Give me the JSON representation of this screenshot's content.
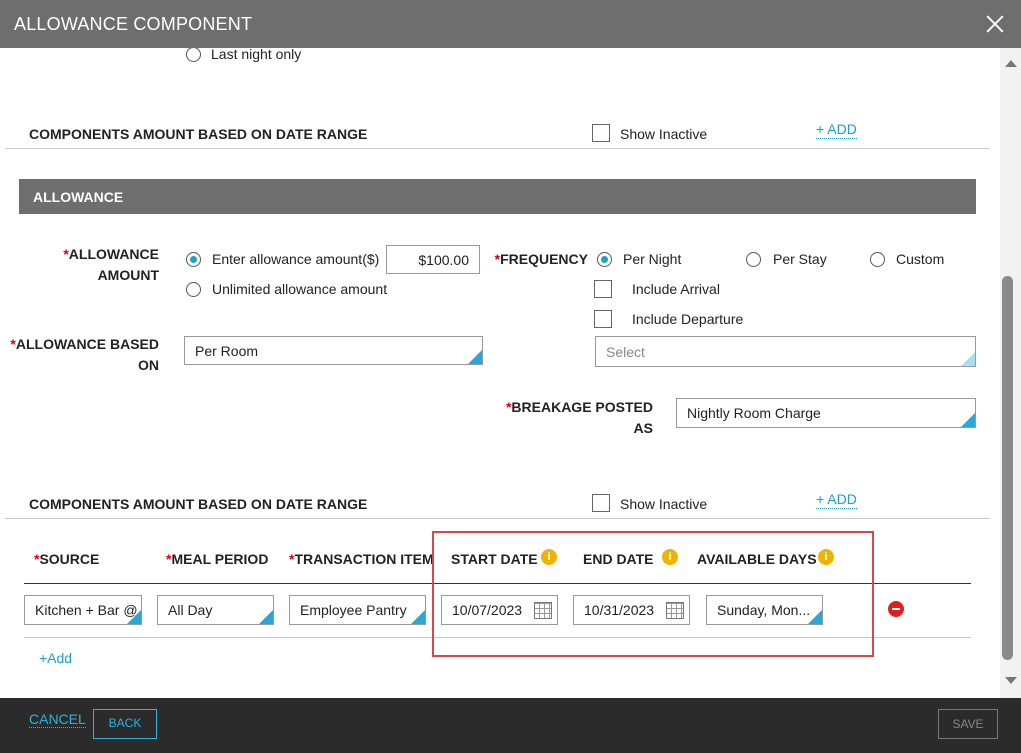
{
  "dialog": {
    "title": "ALLOWANCE COMPONENT"
  },
  "top_radio": {
    "label": "Last night only"
  },
  "components_section_1": {
    "title": "COMPONENTS AMOUNT BASED ON DATE RANGE",
    "show_inactive_label": "Show Inactive",
    "add_label": "+ ADD"
  },
  "allowance": {
    "band_title": "ALLOWANCE",
    "amount_label_line1": "ALLOWANCE",
    "amount_label_line2": "AMOUNT",
    "enter_amount_label": "Enter allowance amount($)",
    "amount_value": "$100.00",
    "unlimited_label": "Unlimited allowance amount",
    "based_on_label_line1": "ALLOWANCE BASED",
    "based_on_label_line2": "ON",
    "based_on_value": "Per Room",
    "required_mark": "*"
  },
  "frequency": {
    "label": "FREQUENCY",
    "options": [
      "Per Night",
      "Per Stay",
      "Custom"
    ],
    "include_arrival": "Include Arrival",
    "include_departure": "Include Departure",
    "select_placeholder": "Select"
  },
  "breakage": {
    "label_line1": "BREAKAGE POSTED",
    "label_line2": "AS",
    "value": "Nightly Room Charge"
  },
  "components_section_2": {
    "title": "COMPONENTS AMOUNT BASED ON DATE RANGE",
    "show_inactive_label": "Show Inactive",
    "add_label": "+ ADD"
  },
  "table": {
    "headers": {
      "source": "SOURCE",
      "meal_period": "MEAL PERIOD",
      "transaction_item": "TRANSACTION ITEM",
      "start_date": "START DATE",
      "end_date": "END DATE",
      "available_days": "AVAILABLE DAYS"
    },
    "row": {
      "source": "Kitchen + Bar @",
      "meal_period": "All Day",
      "transaction_item": "Employee Pantry",
      "start_date": "10/07/2023",
      "end_date": "10/31/2023",
      "available_days": "Sunday, Mon..."
    },
    "add_row_label": "+Add"
  },
  "info_icon_glyph": "i",
  "footer": {
    "cancel_label": "CANCEL",
    "back_label": "BACK",
    "save_label": "SAVE"
  },
  "colors": {
    "accent": "#2aa7d5",
    "title_bar": "#6e6e6e",
    "footer": "#2b2b2b",
    "info_icon": "#f0b400",
    "remove_icon": "#e02020",
    "highlight_box": "#d94848"
  }
}
